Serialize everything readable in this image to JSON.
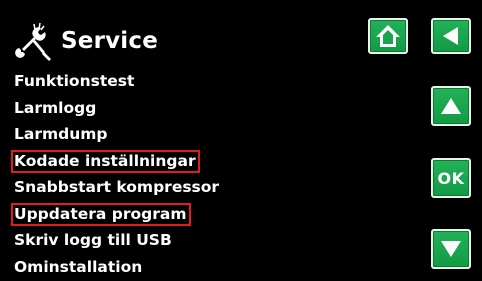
{
  "header": {
    "title": "Service",
    "icon": "tools-icon"
  },
  "menu": {
    "items": [
      {
        "label": "Funktionstest",
        "marked": false
      },
      {
        "label": "Larmlogg",
        "marked": false
      },
      {
        "label": "Larmdump",
        "marked": false
      },
      {
        "label": "Kodade inställningar",
        "marked": true
      },
      {
        "label": "Snabbstart kompressor",
        "marked": false
      },
      {
        "label": "Uppdatera program",
        "marked": true
      },
      {
        "label": "Skriv logg till USB",
        "marked": false
      },
      {
        "label": "Ominstallation",
        "marked": false
      }
    ]
  },
  "buttons": {
    "home_icon": "home-icon",
    "back_icon": "back-arrow-icon",
    "up_icon": "up-arrow-icon",
    "ok_label": "OK",
    "down_icon": "down-arrow-icon"
  },
  "colors": {
    "background": "#000000",
    "text": "#ffffff",
    "button_green": "#1aa34e",
    "highlight_border": "#e01e1e"
  }
}
